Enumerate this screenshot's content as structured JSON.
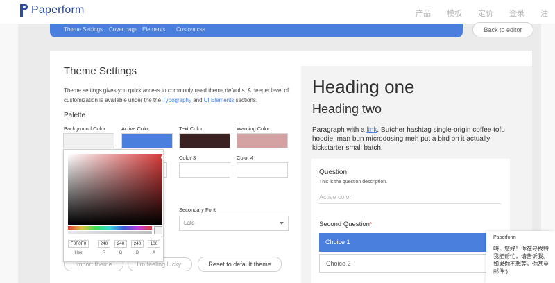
{
  "brand": {
    "name": "Paperform",
    "color": "#2f4a9e"
  },
  "nav": [
    "产品",
    "模板",
    "定价",
    "登录",
    "注"
  ],
  "tabs": [
    "Theme Settings",
    "Cover page",
    "Elements",
    "Custom css"
  ],
  "back_button": "Back to editor",
  "theme": {
    "title": "Theme Settings",
    "desc_pre": "Theme settings gives you quick access to commonly used theme defaults. A deeper level of customization is available under the the ",
    "desc_link1": "Typography",
    "desc_mid": " and ",
    "desc_link2": "UI Elements",
    "desc_post": " sections.",
    "palette_label": "Palette",
    "colors": [
      {
        "label": "Background Color",
        "value": "#f0f0f0"
      },
      {
        "label": "Active Color",
        "value": "#4a7fdd"
      },
      {
        "label": "Text Color",
        "value": "#3a2222"
      },
      {
        "label": "Warning Color",
        "value": "#d4a2a2"
      }
    ],
    "extra_colors": [
      "Color 3",
      "Color 4"
    ],
    "secondary_font_label": "Secondary Font",
    "secondary_font_value": "Lato",
    "buttons": {
      "import": "Import theme",
      "lucky": "I'm feeling lucky!",
      "reset": "Reset to default theme"
    }
  },
  "picker": {
    "hex": "F0F0F0",
    "r": "240",
    "g": "240",
    "b": "240",
    "a": "100",
    "labels": [
      "Hex",
      "R",
      "G",
      "B",
      "A"
    ]
  },
  "preview": {
    "heading_one": "Heading one",
    "heading_two": "Heading two",
    "para_pre": "Paragraph with a ",
    "para_link": "link",
    "para_post": ". Butcher hashtag single-origin coffee tofu hoodie, man bun microdosing meh put a bird on it actually kickstarter small batch.",
    "question_title": "Question",
    "question_desc": "This is the question description.",
    "question_placeholder": "Active color",
    "second_question": "Second Question",
    "required_mark": "*",
    "choices": [
      "Choice 1",
      "Choice 2"
    ]
  },
  "chat": {
    "name": "Paperform",
    "message": "嗨，您好！你在寻找特\n我能帮忙，请告诉我。\n如果你不想等，你甚至\n邮件:)"
  }
}
